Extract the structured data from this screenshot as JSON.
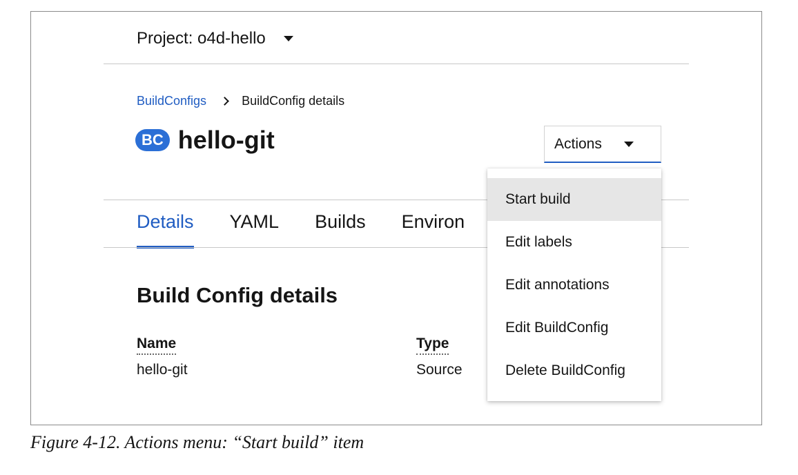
{
  "project": {
    "label": "Project: o4d-hello"
  },
  "breadcrumb": {
    "parent": "BuildConfigs",
    "current": "BuildConfig details"
  },
  "resource": {
    "badge": "BC",
    "name": "hello-git"
  },
  "actions": {
    "label": "Actions",
    "menu": [
      "Start build",
      "Edit labels",
      "Edit annotations",
      "Edit BuildConfig",
      "Delete BuildConfig"
    ],
    "highlighted_index": 0
  },
  "tabs": [
    "Details",
    "YAML",
    "Builds",
    "Environ"
  ],
  "active_tab": "Details",
  "details": {
    "title": "Build Config details",
    "fields": [
      {
        "label": "Name",
        "value": "hello-git"
      },
      {
        "label": "Type",
        "value": "Source"
      }
    ]
  },
  "caption": "Figure 4-12. Actions menu: “Start build” item",
  "colors": {
    "accent": "#1f5cc2",
    "badge": "#2b6fd6",
    "menu_hover": "#e6e6e6"
  }
}
